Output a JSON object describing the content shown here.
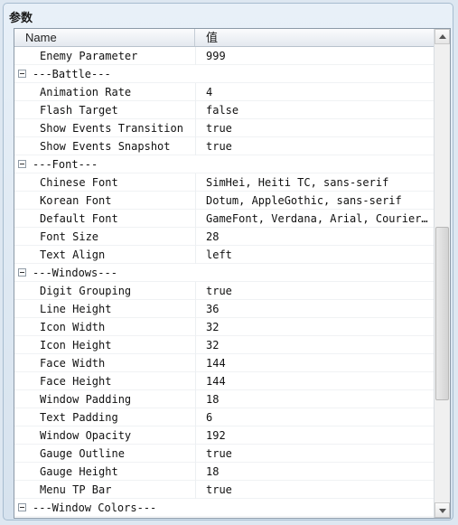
{
  "panel": {
    "title": "参数"
  },
  "grid": {
    "columns": {
      "name": "Name",
      "value": "值"
    },
    "rows": [
      {
        "type": "prop",
        "name": "Enemy Parameter",
        "value": "999"
      },
      {
        "type": "cat",
        "name": "---Battle---",
        "value": ""
      },
      {
        "type": "prop",
        "name": "Animation Rate",
        "value": "4"
      },
      {
        "type": "prop",
        "name": "Flash Target",
        "value": "false"
      },
      {
        "type": "prop",
        "name": "Show Events Transition",
        "value": "true"
      },
      {
        "type": "prop",
        "name": "Show Events Snapshot",
        "value": "true"
      },
      {
        "type": "cat",
        "name": "---Font---",
        "value": ""
      },
      {
        "type": "prop",
        "name": "Chinese Font",
        "value": "SimHei, Heiti TC, sans-serif"
      },
      {
        "type": "prop",
        "name": "Korean Font",
        "value": "Dotum, AppleGothic, sans-serif"
      },
      {
        "type": "prop",
        "name": "Default Font",
        "value": "GameFont, Verdana, Arial, Courier …"
      },
      {
        "type": "prop",
        "name": "Font Size",
        "value": "28"
      },
      {
        "type": "prop",
        "name": "Text Align",
        "value": "left"
      },
      {
        "type": "cat",
        "name": "---Windows---",
        "value": ""
      },
      {
        "type": "prop",
        "name": "Digit Grouping",
        "value": "true"
      },
      {
        "type": "prop",
        "name": "Line Height",
        "value": "36"
      },
      {
        "type": "prop",
        "name": "Icon Width",
        "value": "32"
      },
      {
        "type": "prop",
        "name": "Icon Height",
        "value": "32"
      },
      {
        "type": "prop",
        "name": "Face Width",
        "value": "144"
      },
      {
        "type": "prop",
        "name": "Face Height",
        "value": "144"
      },
      {
        "type": "prop",
        "name": "Window Padding",
        "value": "18"
      },
      {
        "type": "prop",
        "name": "Text Padding",
        "value": "6"
      },
      {
        "type": "prop",
        "name": "Window Opacity",
        "value": "192"
      },
      {
        "type": "prop",
        "name": "Gauge Outline",
        "value": "true"
      },
      {
        "type": "prop",
        "name": "Gauge Height",
        "value": "18"
      },
      {
        "type": "prop",
        "name": "Menu TP Bar",
        "value": "true"
      },
      {
        "type": "cat",
        "name": "---Window Colors---",
        "value": ""
      }
    ]
  },
  "icons": {
    "collapse": "collapse-minus-icon",
    "scroll_up": "scroll-up-arrow-icon",
    "scroll_down": "scroll-down-arrow-icon"
  }
}
